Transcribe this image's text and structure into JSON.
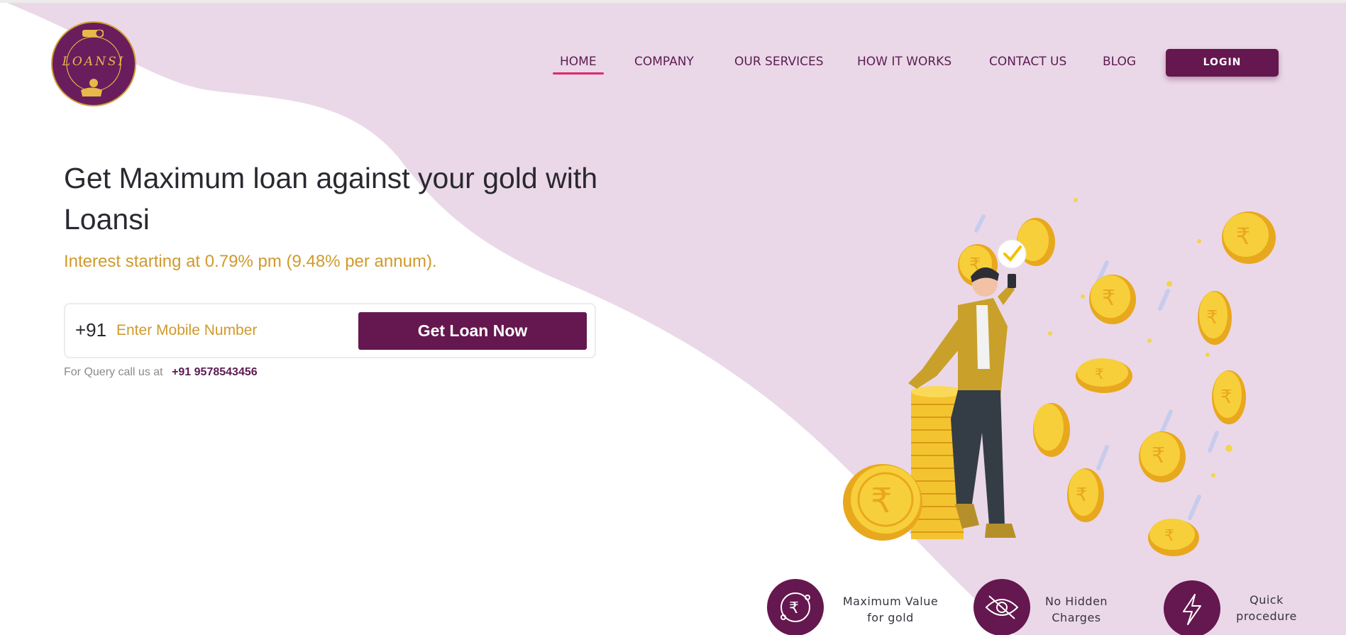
{
  "brand": {
    "logo_text": "LOANSI",
    "primary_color": "#65174f",
    "accent_color": "#d09a2c",
    "bg_tint": "#ead8e8"
  },
  "nav": {
    "items": [
      {
        "label": "HOME",
        "active": true
      },
      {
        "label": "COMPANY"
      },
      {
        "label": "OUR SERVICES"
      },
      {
        "label": "HOW IT WORKS"
      },
      {
        "label": "CONTACT US"
      },
      {
        "label": "BLOG"
      }
    ],
    "login_label": "LOGIN"
  },
  "hero": {
    "title_line1": "Get Maximum loan against your gold with",
    "title_line2": "Loansi",
    "subtitle": "Interest starting at 0.79% pm (9.48% per annum).",
    "country_code": "+91",
    "mobile_placeholder": "Enter Mobile Number",
    "cta_label": "Get Loan Now",
    "query_text": "For Query call us at",
    "query_phone": "+91 9578543456"
  },
  "features": [
    {
      "icon": "rupee-icon",
      "line1": "Maximum Value",
      "line2": "for gold"
    },
    {
      "icon": "eye-slash-icon",
      "line1": "No Hidden",
      "line2": "Charges"
    },
    {
      "icon": "lightning-icon",
      "line1": "Quick",
      "line2": "procedure"
    }
  ]
}
